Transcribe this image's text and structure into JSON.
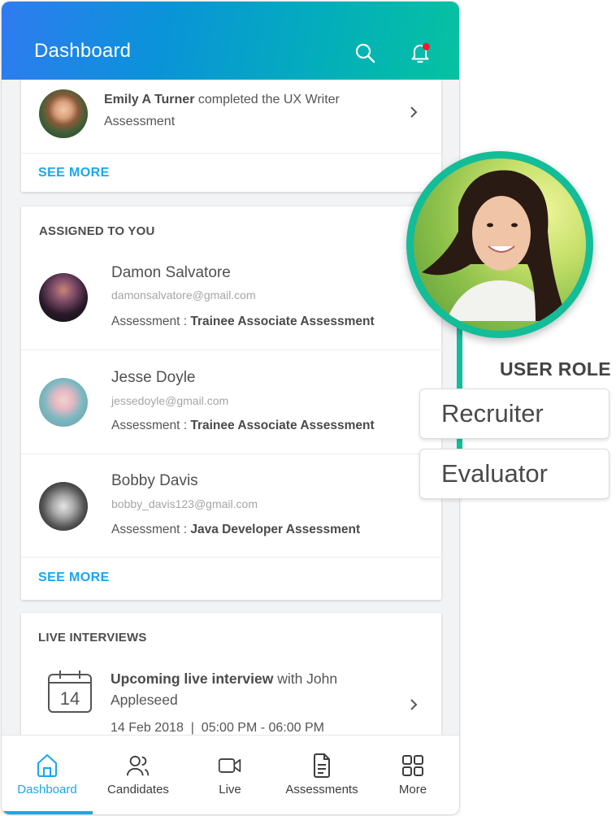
{
  "app_bar": {
    "title": "Dashboard",
    "search_icon": "search-icon",
    "notification_icon": "bell-icon",
    "notification_badge": true,
    "gradient_start": "#2f7bf0",
    "gradient_end": "#06c2a0"
  },
  "activity_card": {
    "item": {
      "name": "Emily A Turner",
      "action": " completed the UX Writer Assessment"
    },
    "see_more": "SEE MORE"
  },
  "assigned_card": {
    "title": "ASSIGNED TO YOU",
    "items": [
      {
        "name": "Damon Salvatore",
        "email": "damonsalvatore@gmail.com",
        "assessment_label": "Assessment : ",
        "assessment": "Trainee Associate Assessment"
      },
      {
        "name": "Jesse Doyle",
        "email": "jessedoyle@gmail.com",
        "assessment_label": "Assessment : ",
        "assessment": "Trainee Associate Assessment"
      },
      {
        "name": "Bobby Davis",
        "email": "bobby_davis123@gmail.com",
        "assessment_label": "Assessment : ",
        "assessment": "Java Developer Assessment"
      }
    ],
    "see_more": "SEE MORE"
  },
  "live_card": {
    "title": "LIVE INTERVIEWS",
    "item": {
      "calendar_day": "14",
      "title_bold": "Upcoming live interview",
      "title_rest": " with John Appleseed",
      "date": "14 Feb 2018",
      "separator": "|",
      "time": "05:00 PM - 06:00 PM"
    }
  },
  "bottom_nav": {
    "items": [
      {
        "label": "Dashboard",
        "icon": "home-icon",
        "active": true
      },
      {
        "label": "Candidates",
        "icon": "users-icon",
        "active": false
      },
      {
        "label": "Live",
        "icon": "video-icon",
        "active": false
      },
      {
        "label": "Assessments",
        "icon": "document-icon",
        "active": false
      },
      {
        "label": "More",
        "icon": "grid-icon",
        "active": false
      }
    ],
    "active_color": "#1aa6ee"
  },
  "user_role_overlay": {
    "label": "USER ROLE",
    "options": [
      "Recruiter",
      "Evaluator"
    ],
    "accent_color": "#12bd98"
  }
}
